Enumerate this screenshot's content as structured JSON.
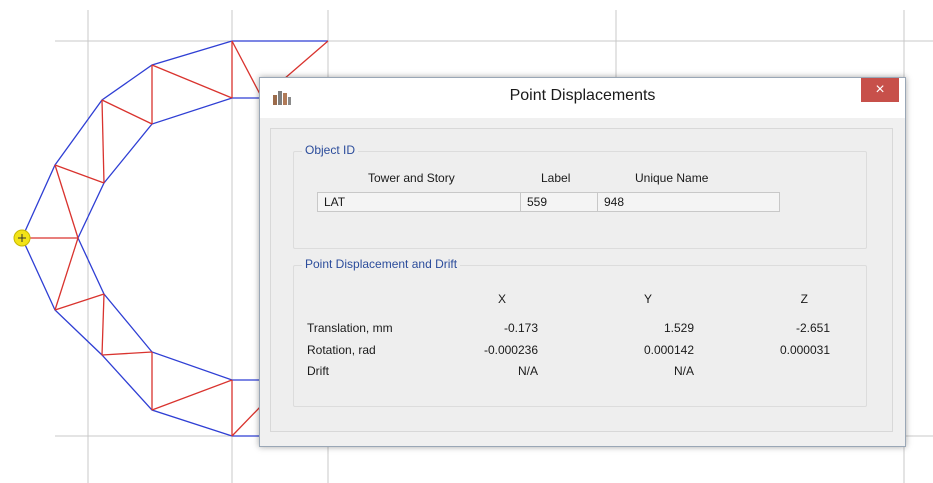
{
  "dialog": {
    "title": "Point Displacements",
    "close_glyph": "×",
    "object_id": {
      "group_title": "Object ID",
      "headers": {
        "tower_story": "Tower and Story",
        "label": "Label",
        "unique_name": "Unique Name"
      },
      "values": {
        "tower_story": "LAT",
        "label": "559",
        "unique_name": "948"
      }
    },
    "displacement": {
      "group_title": "Point Displacement and Drift",
      "columns": [
        "X",
        "Y",
        "Z"
      ],
      "rows": [
        {
          "label": "Translation, mm",
          "x": "-0.173",
          "y": "1.529",
          "z": "-2.651"
        },
        {
          "label": "Rotation, rad",
          "x": "-0.000236",
          "y": "0.000142",
          "z": "0.000031"
        },
        {
          "label": "Drift",
          "x": "N/A",
          "y": "N/A",
          "z": ""
        }
      ]
    }
  },
  "colors": {
    "member_blue": "#2f3fd4",
    "brace_red": "#d9332e",
    "grid": "#c9c9c9",
    "selected_point": "#f2e318"
  }
}
